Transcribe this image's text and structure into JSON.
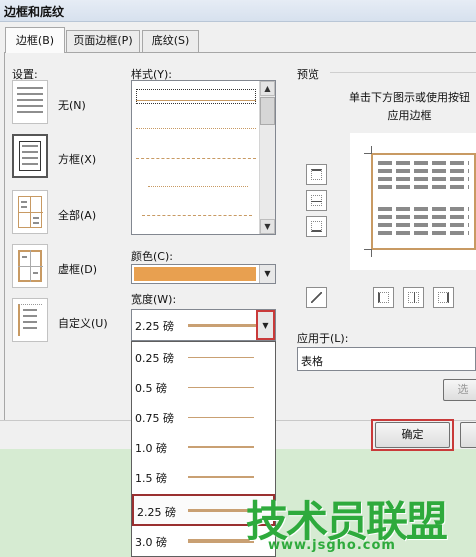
{
  "window": {
    "title": "边框和底纹"
  },
  "tabs": [
    {
      "label": "边框(B)",
      "active": true
    },
    {
      "label": "页面边框(P)",
      "active": false
    },
    {
      "label": "底纹(S)",
      "active": false
    }
  ],
  "settings": {
    "label": "设置:",
    "options": [
      {
        "label": "无(N)",
        "selected": false
      },
      {
        "label": "方框(X)",
        "selected": true
      },
      {
        "label": "全部(A)",
        "selected": false
      },
      {
        "label": "虚框(D)",
        "selected": false
      },
      {
        "label": "自定义(U)",
        "selected": false
      }
    ]
  },
  "style": {
    "label": "样式(Y):",
    "lines": [
      "none",
      "solid",
      "dotted",
      "dash-dot",
      "dotted-fine",
      "dashed",
      "dash-dot-dot"
    ]
  },
  "color": {
    "label": "颜色(C):",
    "value": "#e8a050"
  },
  "width": {
    "label": "宽度(W):",
    "value": "2.25 磅",
    "options": [
      "0.25 磅",
      "0.5 磅",
      "0.75 磅",
      "1.0 磅",
      "1.5 磅",
      "2.25 磅",
      "3.0 磅"
    ],
    "selected": "2.25 磅"
  },
  "preview": {
    "label": "预览",
    "instruction_line1": "单击下方图示或使用按钮",
    "instruction_line2": "应用边框"
  },
  "apply_to": {
    "label": "应用于(L):",
    "value": "表格"
  },
  "options_button": {
    "label": "选"
  },
  "ok_button": {
    "label": "确定"
  },
  "watermark": {
    "text": "技术员联盟",
    "url": "www.jsgho.com"
  },
  "colors": {
    "accent_border": "#c93a3a",
    "line_color": "#cc9a66",
    "watermark_green": "#2eaa3c"
  }
}
